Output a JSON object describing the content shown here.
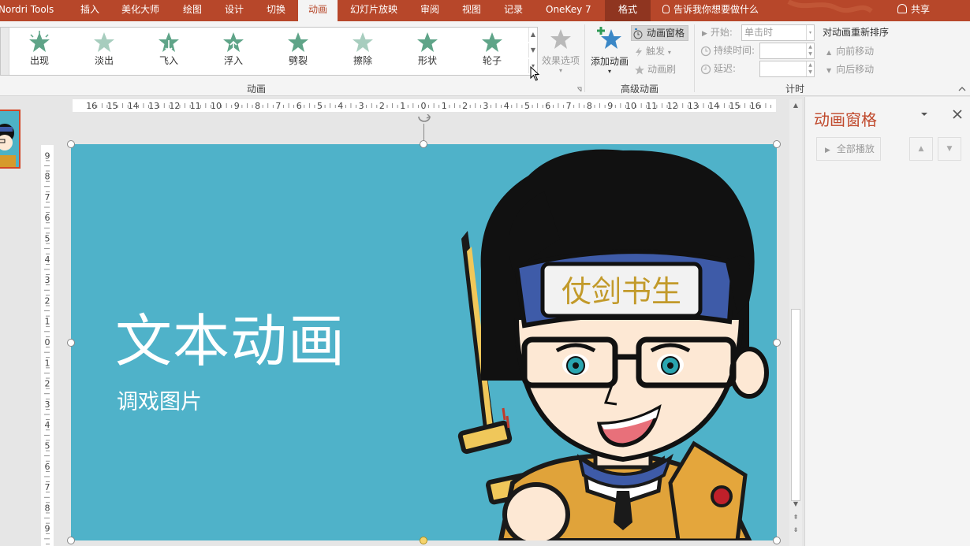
{
  "tabs": [
    {
      "label": "Nordri Tools",
      "active": false
    },
    {
      "label": "插入",
      "active": false
    },
    {
      "label": "美化大师",
      "active": false
    },
    {
      "label": "绘图",
      "active": false
    },
    {
      "label": "设计",
      "active": false
    },
    {
      "label": "切换",
      "active": false
    },
    {
      "label": "动画",
      "active": true
    },
    {
      "label": "幻灯片放映",
      "active": false
    },
    {
      "label": "审阅",
      "active": false
    },
    {
      "label": "视图",
      "active": false
    },
    {
      "label": "记录",
      "active": false
    },
    {
      "label": "OneKey 7",
      "active": false
    },
    {
      "label": "格式",
      "active": false,
      "contextual": true
    }
  ],
  "tell_me": "告诉我你想要做什么",
  "share": "共享",
  "colors": {
    "title_bar": "#b7472a",
    "ribbon": "#f4f4f4",
    "slide_bg": "#4fb2c9",
    "accent_text": "#c0492c",
    "star": "#5fa488"
  },
  "animation_gallery": {
    "items": [
      "出现",
      "淡出",
      "飞入",
      "浮入",
      "劈裂",
      "擦除",
      "形状",
      "轮子"
    ],
    "group_label": "动画"
  },
  "effect_options": "效果选项",
  "advanced_animation": {
    "add_animation": "添加动画",
    "animation_pane": "动画窗格",
    "trigger": "触发",
    "animation_painter": "动画刷",
    "group_label": "高级动画"
  },
  "timing": {
    "start_label": "开始:",
    "start_value": "单击时",
    "duration_label": "持续时间:",
    "delay_label": "延迟:",
    "group_label": "计时"
  },
  "reorder": {
    "title": "对动画重新排序",
    "move_earlier": "向前移动",
    "move_later": "向后移动"
  },
  "slide": {
    "title": "文本动画",
    "subtitle": "调戏图片",
    "headband_text": "仗剑书生"
  },
  "pane": {
    "title": "动画窗格",
    "play_all": "全部播放"
  }
}
